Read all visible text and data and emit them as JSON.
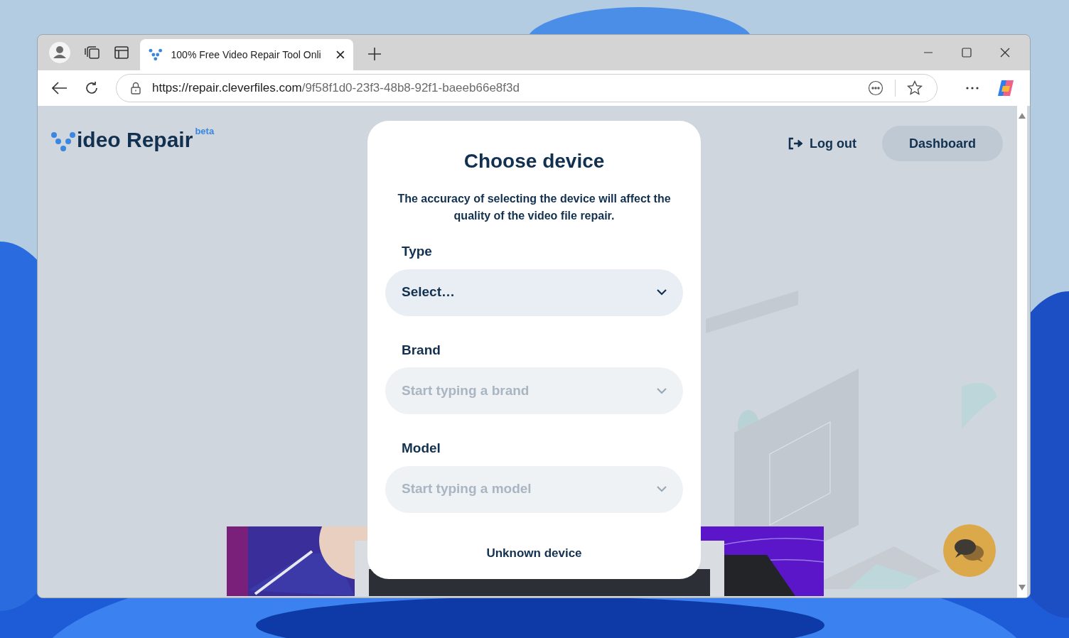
{
  "browser": {
    "tabs": [
      {
        "title": "100% Free Video Repair Tool Onli",
        "selected": true
      }
    ],
    "url": {
      "host": "https://repair.cleverfiles.com",
      "path": "/9f58f1d0-23f3-48b8-92f1-baeeb66e8f3d"
    }
  },
  "header": {
    "logo": {
      "text": "ideo Repair",
      "badge": "beta"
    },
    "logout": "Log out",
    "dashboard": "Dashboard"
  },
  "dialog": {
    "title": "Choose device",
    "description": "The accuracy of selecting the device will affect the quality of the video file repair.",
    "fields": [
      {
        "label": "Type",
        "value": "Select…",
        "disabled": false
      },
      {
        "label": "Brand",
        "placeholder": "Start typing a brand",
        "disabled": true
      },
      {
        "label": "Model",
        "placeholder": "Start typing a model",
        "disabled": true
      }
    ],
    "link": "Unknown device"
  }
}
